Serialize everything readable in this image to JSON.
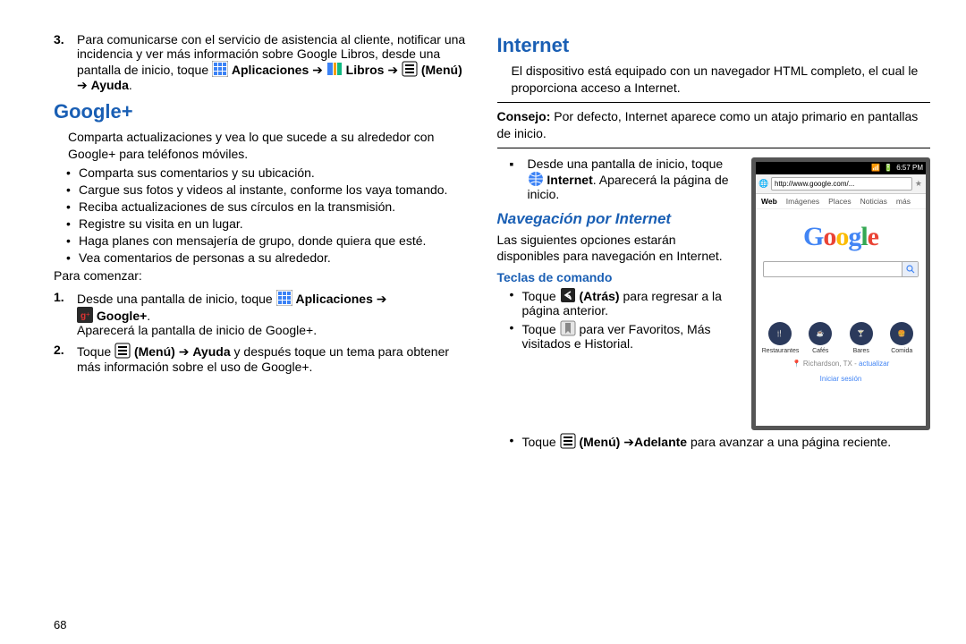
{
  "pageNumber": "68",
  "left": {
    "step3": {
      "num": "3.",
      "text_a": "Para comunicarse con el servicio de asistencia al cliente, notificar una incidencia y ver más información sobre Google Libros, desde una pantalla de inicio, toque ",
      "apps": "Aplicaciones",
      "arrow": "➔",
      "libros": "Libros",
      "menu": "(Menú)",
      "ayuda": "Ayuda"
    },
    "googleplus": {
      "title": "Google+",
      "intro": "Comparta actualizaciones y vea lo que sucede a su alrededor con Google+ para teléfonos móviles.",
      "bullets": [
        "Comparta sus comentarios y su ubicación.",
        "Cargue sus fotos y videos al instante, conforme los vaya tomando.",
        "Reciba actualizaciones de sus círculos en la transmisión.",
        "Registre su visita en un lugar.",
        "Haga planes con mensajería de grupo, donde quiera que esté.",
        "Vea comentarios de personas a su alrededor."
      ],
      "para_comenzar": "Para comenzar:",
      "step1": {
        "num": "1.",
        "a": "Desde una pantalla de inicio, toque ",
        "apps": "Aplicaciones",
        "arrow": "➔",
        "gplus": "Google+",
        "after": "Aparecerá la pantalla de inicio de Google+."
      },
      "step2": {
        "num": "2.",
        "a": "Toque ",
        "menu": "(Menú)",
        "arrow": "➔",
        "ayuda": "Ayuda",
        "b": " y después toque un tema para obtener más información sobre el uso de Google+."
      }
    }
  },
  "right": {
    "internet": {
      "title": "Internet",
      "intro": "El dispositivo está equipado con un navegador HTML completo, el cual le proporciona acceso a Internet.",
      "consejo_label": "Consejo:",
      "consejo": " Por defecto, Internet aparece como un atajo primario en pantallas de inicio.",
      "instruction_a": "Desde una pantalla de inicio, toque ",
      "instruction_bold": "Internet",
      "instruction_b": ". Aparecerá la página de inicio.",
      "nav_title": "Navegación por Internet",
      "nav_intro": "Las siguientes opciones estarán disponibles para navegación en Internet.",
      "teclas": "Teclas de comando",
      "b1_a": "Toque ",
      "b1_bold": "(Atrás)",
      "b1_b": " para regresar a la página anterior.",
      "b2_a": "Toque ",
      "b2_b": " para ver Favoritos, Más visitados e Historial.",
      "b3_a": "Toque ",
      "b3_bold1": "(Menú)",
      "b3_arrow": "➔",
      "b3_bold2": "Adelante",
      "b3_b": " para avanzar a una página reciente."
    },
    "phone": {
      "time": "6:57 PM",
      "url": "http://www.google.com/...",
      "tabs": [
        "Web",
        "Imágenes",
        "Places",
        "Noticias",
        "más"
      ],
      "logo": "Google",
      "cats": [
        "Restaurantes",
        "Cafés",
        "Bares",
        "Comida"
      ],
      "location_a": "Richardson, TX",
      "location_sep": " - ",
      "location_b": "actualizar",
      "signin": "Iniciar sesión"
    }
  }
}
